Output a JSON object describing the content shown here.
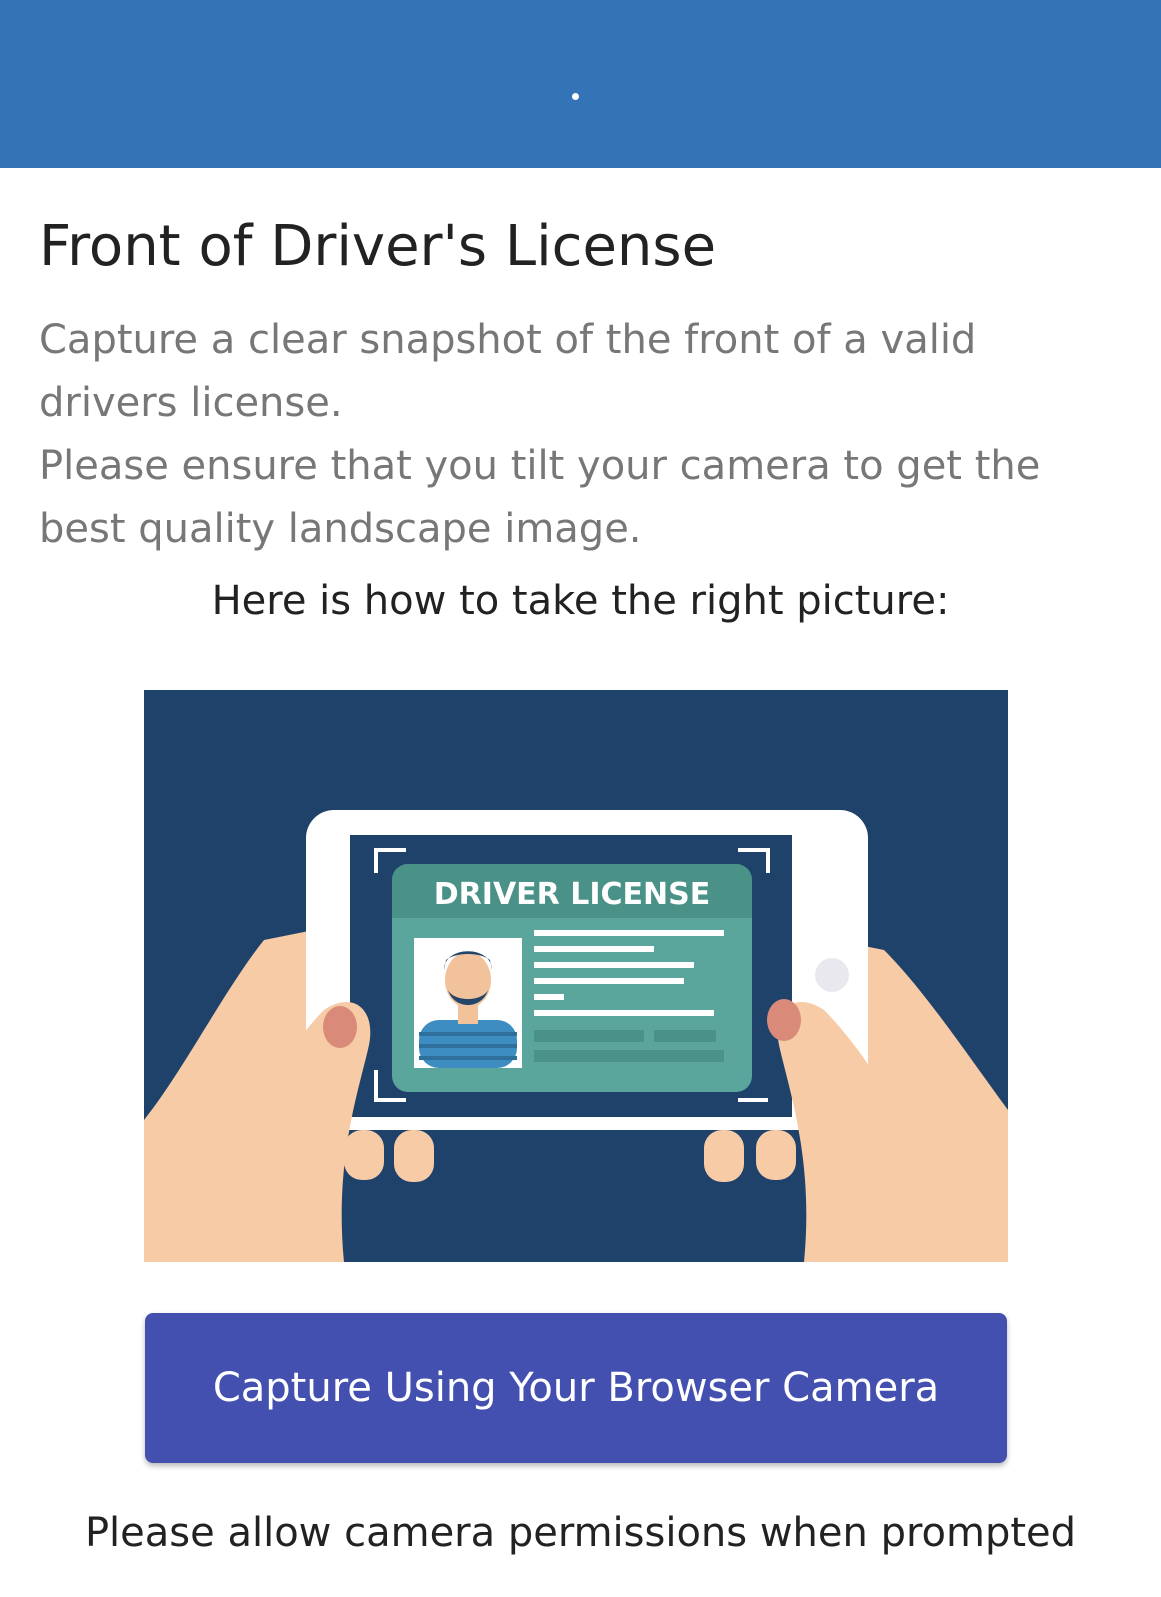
{
  "header": {
    "indicator": "loading-dot"
  },
  "main": {
    "title": "Front of Driver's License",
    "description_line1": "Capture a clear snapshot of the front of a valid",
    "description_line2": "drivers license.",
    "description_line3": "Please ensure that you tilt your camera to get the",
    "description_line4": "best quality landscape image.",
    "howto_label": "Here is how to take the right picture:",
    "illustration": {
      "card_title": "DRIVER LICENSE",
      "icon": "phone-capturing-license-illustration"
    },
    "capture_button_label": "Capture Using Your Browser Camera",
    "permission_note": "Please allow camera permissions when prompted"
  },
  "colors": {
    "header": "#3474b6",
    "button": "#4350b0",
    "illustration_bg": "#1f426b",
    "card": "#5aa69c",
    "card_header": "#4a9187"
  }
}
